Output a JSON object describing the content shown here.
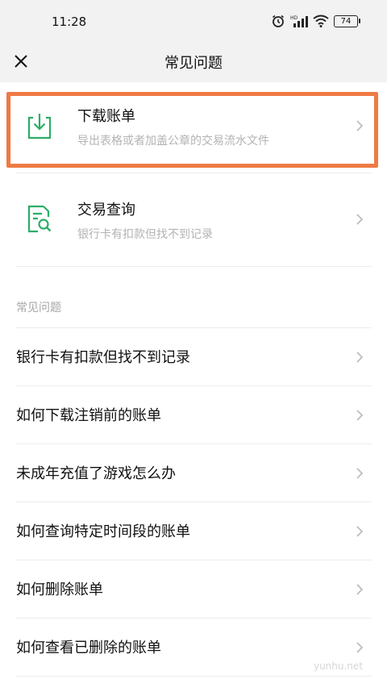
{
  "status_bar": {
    "time": "11:28",
    "battery": "74"
  },
  "header": {
    "title": "常见问题"
  },
  "entries": [
    {
      "title": "下载账单",
      "desc": "导出表格或者加盖公章的交易流水文件"
    },
    {
      "title": "交易查询",
      "desc": "银行卡有扣款但找不到记录"
    }
  ],
  "faq_section": {
    "label": "常见问题",
    "items": [
      "银行卡有扣款但找不到记录",
      "如何下载注销前的账单",
      "未成年充值了游戏怎么办",
      "如何查询特定时间段的账单",
      "如何删除账单",
      "如何查看已删除的账单"
    ]
  },
  "watermark": "yunhu.net",
  "colors": {
    "accent_green": "#2aae67",
    "highlight_orange": "#ee7a45"
  }
}
